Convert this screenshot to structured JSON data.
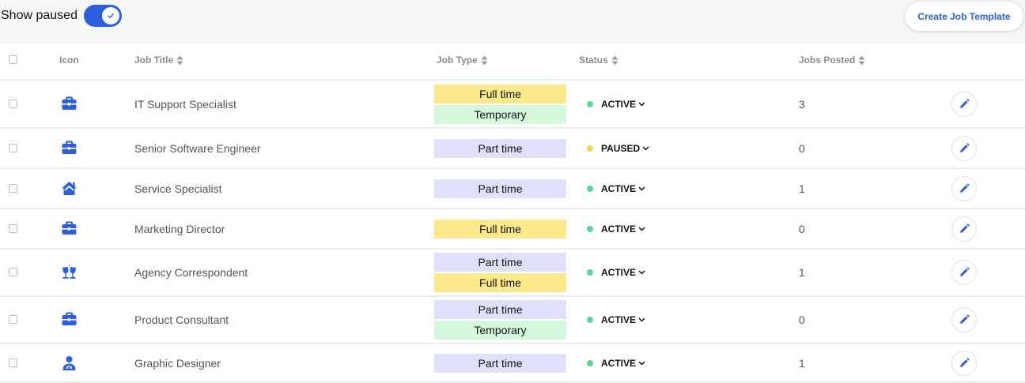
{
  "toolbar": {
    "show_paused_label": "Show paused",
    "show_paused_on": true,
    "create_button_label": "Create Job Template"
  },
  "colors": {
    "accent": "#2c5fdc",
    "active_dot": "#5dd39e",
    "paused_dot": "#f8d35a",
    "full_time_bg": "#fbe98c",
    "temporary_bg": "#d3f8dc",
    "part_time_bg": "#e1e0fb"
  },
  "table": {
    "headers": {
      "icon": "Icon",
      "job_title": "Job Title",
      "job_type": "Job Type",
      "status": "Status",
      "jobs_posted": "Jobs Posted"
    },
    "rows": [
      {
        "icon": "briefcase-icon",
        "title": "IT Support Specialist",
        "types": [
          "Full time",
          "Temporary"
        ],
        "status": "ACTIVE",
        "jobs_posted": "3"
      },
      {
        "icon": "briefcase-icon",
        "title": "Senior Software Engineer",
        "types": [
          "Part time"
        ],
        "status": "PAUSED",
        "jobs_posted": "0"
      },
      {
        "icon": "house-icon",
        "title": "Service Specialist",
        "types": [
          "Part time"
        ],
        "status": "ACTIVE",
        "jobs_posted": "1"
      },
      {
        "icon": "briefcase-icon",
        "title": "Marketing Director",
        "types": [
          "Full time"
        ],
        "status": "ACTIVE",
        "jobs_posted": "0"
      },
      {
        "icon": "glasses-toast-icon",
        "title": "Agency Correspondent",
        "types": [
          "Part time",
          "Full time"
        ],
        "status": "ACTIVE",
        "jobs_posted": "1"
      },
      {
        "icon": "briefcase-icon",
        "title": "Product Consultant",
        "types": [
          "Part time",
          "Temporary"
        ],
        "status": "ACTIVE",
        "jobs_posted": "0"
      },
      {
        "icon": "doctor-icon",
        "title": "Graphic Designer",
        "types": [
          "Part time"
        ],
        "status": "ACTIVE",
        "jobs_posted": "1"
      }
    ]
  }
}
